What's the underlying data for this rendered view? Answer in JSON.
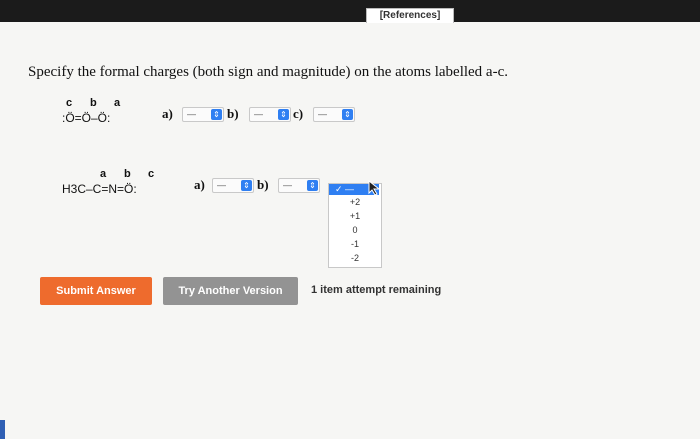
{
  "header": {
    "references_tab": "[References]"
  },
  "question": {
    "text": "Specify the formal charges (both sign and magnitude) on the atoms labelled a-c."
  },
  "molecule1": {
    "labels": [
      "c",
      "b",
      "a"
    ],
    "formula": ":Ö=Ö–Ö:"
  },
  "molecule2": {
    "labels": [
      "a",
      "b",
      "c"
    ],
    "formula": "H3C–C=N=Ö:"
  },
  "row1": {
    "answers": [
      {
        "label": "a)",
        "value": "—"
      },
      {
        "label": "b)",
        "value": "—"
      },
      {
        "label": "c)",
        "value": "—"
      }
    ]
  },
  "row2": {
    "answers": [
      {
        "label": "a)",
        "value": "—"
      },
      {
        "label": "b)",
        "value": "—"
      }
    ],
    "dropdown": {
      "selected": "✓ —",
      "options": [
        "+2",
        "+1",
        "0",
        "-1",
        "-2"
      ]
    }
  },
  "buttons": {
    "submit": "Submit Answer",
    "try_another": "Try Another Version"
  },
  "attempts_text": "1 item attempt remaining",
  "colors": {
    "submit_bg": "#ee6b2d",
    "try_bg": "#939393",
    "select_arrow": "#2f7ff2"
  }
}
